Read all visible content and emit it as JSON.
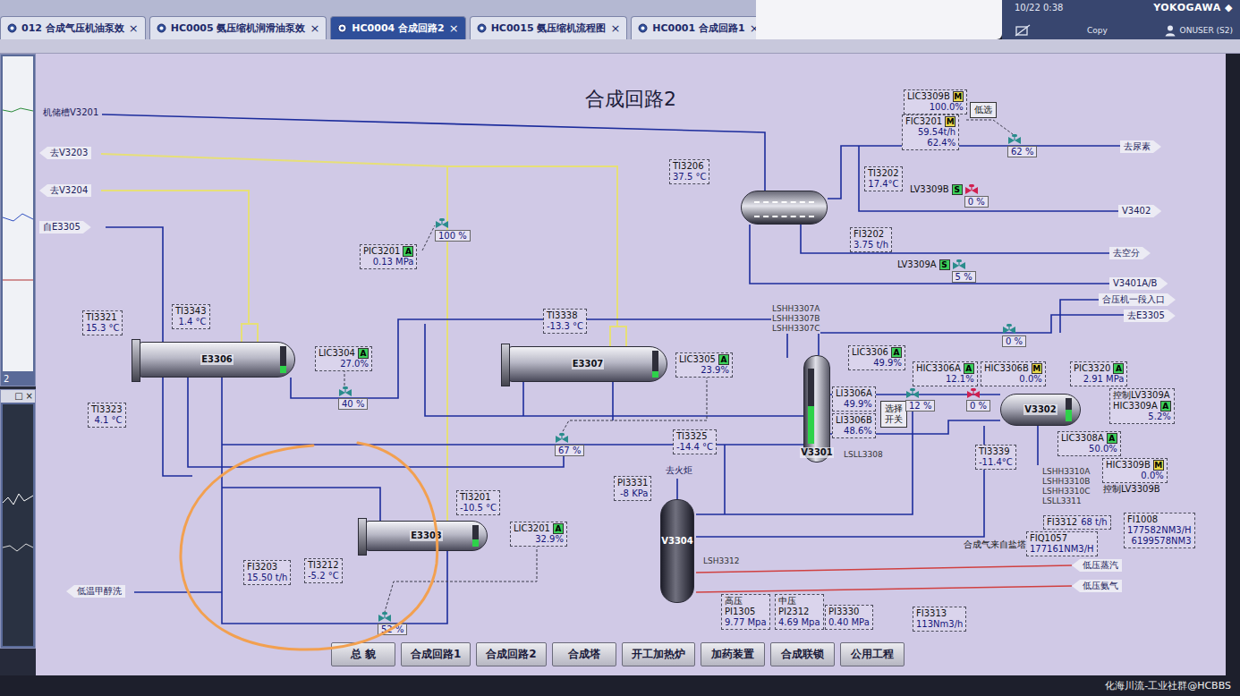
{
  "display": {
    "title": "合成回路2"
  },
  "tabs": [
    {
      "label": "012 合成气压机油泵效",
      "close": "×",
      "selected": false
    },
    {
      "label": "HC0005 氨压缩机润滑油泵效",
      "close": "×",
      "selected": false
    },
    {
      "label": "HC0004 合成回路2",
      "close": "×",
      "selected": true
    },
    {
      "label": "HC0015 氨压缩机流程图",
      "close": "×",
      "selected": false
    },
    {
      "label": "HC0001 合成回路1",
      "close": "×",
      "selected": false
    }
  ],
  "header": {
    "datetime": "10/22 0:38",
    "brand": "YOKOGAWA",
    "brandMark": "◆",
    "copy": "Copy",
    "user": "ONUSER (S2)"
  },
  "side": {
    "trendLabel": "2",
    "controls": [
      "□",
      "×"
    ]
  },
  "instruments": [
    {
      "tag": "TI3321",
      "values": [
        "15.3 °C"
      ]
    },
    {
      "tag": "TI3343",
      "values": [
        "1.4 °C"
      ]
    },
    {
      "tag": "TI3323",
      "values": [
        "4.1 °C"
      ]
    },
    {
      "tag": "LIC3304",
      "mode": "A",
      "modeColor": "#3ccf5a",
      "values": [
        "27.0%"
      ]
    },
    {
      "tag": "PIC3201",
      "mode": "A",
      "modeColor": "#3ccf5a",
      "values": [
        "0.13 MPa"
      ]
    },
    {
      "tag": "TI3338",
      "values": [
        "-13.3 °C"
      ]
    },
    {
      "tag": "LIC3305",
      "mode": "A",
      "modeColor": "#3ccf5a",
      "values": [
        "23.9%"
      ]
    },
    {
      "tag": "TI3325",
      "values": [
        "-14.4 °C"
      ]
    },
    {
      "tag": "TI3206",
      "values": [
        "37.5 °C"
      ]
    },
    {
      "tag": "TI3201",
      "values": [
        "-10.5 °C"
      ]
    },
    {
      "tag": "LIC3201",
      "mode": "A",
      "modeColor": "#3ccf5a",
      "values": [
        "32.9%"
      ]
    },
    {
      "tag": "FI3203",
      "values": [
        "15.50 t/h"
      ]
    },
    {
      "tag": "TI3212",
      "values": [
        "-5.2 °C"
      ]
    },
    {
      "tag": "PI3331",
      "values": [
        "-8 KPa"
      ]
    },
    {
      "prefix": "高压",
      "tag": "PI1305",
      "values": [
        "9.77 Mpa"
      ]
    },
    {
      "prefix": "中压",
      "tag": "PI2312",
      "values": [
        "4.69 Mpa"
      ]
    },
    {
      "tag": "PI3330",
      "values": [
        "0.40 MPa"
      ]
    },
    {
      "tag": "FI3313",
      "values": [
        "113Nm3/h"
      ]
    },
    {
      "tag": "LIC3309B",
      "mode": "M",
      "modeColor": "#e8d84a",
      "values": [
        "100.0%"
      ]
    },
    {
      "tag": "FIC3201",
      "mode": "M",
      "modeColor": "#e8d84a",
      "values": [
        "59.54t/h",
        "62.4%"
      ]
    },
    {
      "tag": "TI3202",
      "values": [
        "17.4°C"
      ]
    },
    {
      "tag": "FI3202",
      "values": [
        "3.75 t/h"
      ]
    },
    {
      "tag": "LIC3306",
      "mode": "A",
      "modeColor": "#3ccf5a",
      "values": [
        "49.9%"
      ]
    },
    {
      "tag": "LI3306A",
      "values": [
        "49.9%"
      ]
    },
    {
      "tag": "LI3306B",
      "values": [
        "48.6%"
      ]
    },
    {
      "tag": "HIC3306A",
      "mode": "A",
      "modeColor": "#3ccf5a",
      "values": [
        "12.1%"
      ]
    },
    {
      "tag": "HIC3306B",
      "mode": "M",
      "modeColor": "#e8d84a",
      "values": [
        "0.0%"
      ]
    },
    {
      "tag": "PIC3320",
      "mode": "A",
      "modeColor": "#3ccf5a",
      "values": [
        "2.91 MPa"
      ]
    },
    {
      "caption": "控制LV3309A",
      "tag": "HIC3309A",
      "mode": "A",
      "modeColor": "#3ccf5a",
      "values": [
        "5.2%"
      ]
    },
    {
      "tag": "LIC3308A",
      "mode": "A",
      "modeColor": "#3ccf5a",
      "values": [
        "50.0%"
      ]
    },
    {
      "tag": "HIC3309B",
      "mode": "M",
      "modeColor": "#e8d84a",
      "values": [
        "0.0%"
      ]
    },
    {
      "tag": "TI3339",
      "values": [
        "-11.4°C"
      ]
    },
    {
      "tag": "FI3312",
      "kind": "inline",
      "values": [
        "68 t/h"
      ]
    },
    {
      "tag": "FIQ1057",
      "values": [
        "177161NM3/H"
      ]
    },
    {
      "tag": "FI1008",
      "values": [
        "177582NM3/H",
        "6199578NM3"
      ]
    }
  ],
  "tagLists": [
    {
      "tags": [
        "LSHH3307A",
        "LSHH3307B",
        "LSHH3307C"
      ]
    },
    {
      "tags": [
        "LSHH3310A",
        "LSHH3310B",
        "LSHH3310C",
        "LSLL3311"
      ]
    },
    {
      "tags": [
        "LSLL3308"
      ]
    },
    {
      "tags": [
        "LSH3312"
      ]
    }
  ],
  "labels": [
    "合成气来自盐塔",
    "控制LV3309B"
  ],
  "boxes": [
    "选择开关",
    "低选"
  ],
  "valves": [
    {
      "reading": "40 %",
      "color": "#2a8c8c"
    },
    {
      "reading": "100 %",
      "color": "#2a8c8c"
    },
    {
      "reading": "67 %",
      "color": "#2a8c8c"
    },
    {
      "reading": "52 %",
      "color": "#2a8c8c"
    },
    {
      "reading": "62 %",
      "color": "#2a8c8c"
    },
    {
      "tag": "LV3309B",
      "mode": "S",
      "modeColor": "#3ccf5a",
      "reading": "0 %",
      "color": "#d02050"
    },
    {
      "tag": "LV3309A",
      "mode": "S",
      "modeColor": "#3ccf5a",
      "reading": "5 %",
      "color": "#2a8c8c"
    },
    {
      "reading": "0 %",
      "color": "#2a8c8c"
    },
    {
      "reading": "12 %",
      "color": "#2a8c8c"
    },
    {
      "reading": "0 %",
      "color": "#d02050"
    }
  ],
  "streams": [
    {
      "label": "机储槽V3201",
      "kind": "plain"
    },
    {
      "label": "去V3203",
      "kind": "left"
    },
    {
      "label": "去V3204",
      "kind": "left"
    },
    {
      "label": "自E3305",
      "kind": "right"
    },
    {
      "label": "低温甲醇洗",
      "kind": "left"
    },
    {
      "label": "去尿素",
      "kind": "right"
    },
    {
      "label": "V3402",
      "kind": "right"
    },
    {
      "label": "去空分",
      "kind": "right"
    },
    {
      "label": "V3401A/B",
      "kind": "right"
    },
    {
      "label": "合压机一段入口",
      "kind": "right"
    },
    {
      "label": "去E3305",
      "kind": "right"
    },
    {
      "label": "低压蒸汽",
      "kind": "left"
    },
    {
      "label": "低压氨气",
      "kind": "left"
    },
    {
      "label": "去火炬",
      "kind": "plain"
    }
  ],
  "equipment": [
    {
      "name": "E3306",
      "kind": "exchanger",
      "level": 0.27
    },
    {
      "name": "E3307",
      "kind": "exchanger",
      "level": 0.239
    },
    {
      "name": "E3303",
      "kind": "exchanger",
      "level": 0.329
    },
    {
      "kind": "drum"
    },
    {
      "name": "V3301",
      "kind": "vessel",
      "level": 0.499
    },
    {
      "name": "V3302",
      "kind": "tank",
      "level": 0.5
    },
    {
      "name": "V3304",
      "kind": "column"
    }
  ],
  "nav": [
    "总 貌",
    "合成回路1",
    "合成回路2",
    "合成塔",
    "开工加热炉",
    "加药装置",
    "合成联锁",
    "公用工程"
  ],
  "watermark": "化海川流-工业社群@HCBBS"
}
